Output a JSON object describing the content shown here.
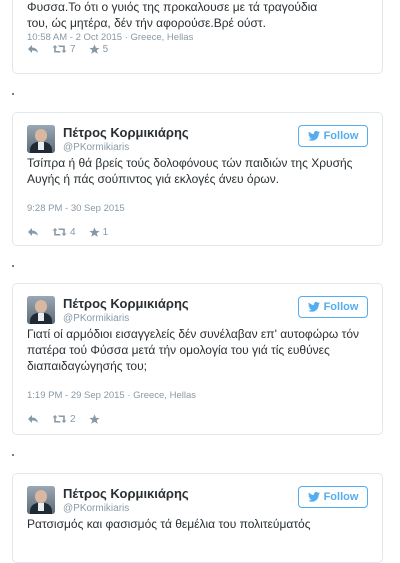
{
  "tweets": [
    {
      "text_line1": "Φυσσα.Το ότι ο γυιός της προκαλουσε με τά τραγούδια",
      "text_line2": "του, ώς μητέρα, δέν τήν αφορούσε.Βρέ ούστ.",
      "meta": "10:58 AM - 2 Oct 2015 · Greece, Hellas",
      "retweets": "7",
      "likes": "5"
    },
    {
      "name": "Πέτρος Κορμικιάρης",
      "handle": "@PKormikiaris",
      "follow_label": "Follow",
      "text": "Τσίπρα ή θά βρείς τούς δολοφόνους τών παιδιών της Χρυσής Αυγής ή πάς σούπιντος γιά εκλογές άνευ όρων.",
      "meta": "9:28 PM - 30 Sep 2015",
      "retweets": "4",
      "likes": "1"
    },
    {
      "name": "Πέτρος Κορμικιάρης",
      "handle": "@PKormikiaris",
      "follow_label": "Follow",
      "text": "Γιατί οί αρμόδιοι εισαγγελείς δέν συνέλαβαν επ' αυτοφώρω τόν πατέρα τού  Φύσσα μετά τήν ομολογία του γιά τίς ευθύνες διαπαιδαγώγησής του;",
      "meta": "1:19 PM - 29 Sep 2015 · Greece, Hellas",
      "retweets": "2",
      "likes": ""
    },
    {
      "name": "Πέτρος Κορμικιάρης",
      "handle": "@PKormikiaris",
      "follow_label": "Follow",
      "text": "Ρατσισμός και φασισμός τά θεμέλια του πολιτεύματός"
    }
  ],
  "colors": {
    "accent": "#55acee",
    "muted": "#8899a6",
    "text": "#292f33",
    "border": "#e1e8ed"
  },
  "icons": [
    "reply-icon",
    "retweet-icon",
    "like-star-icon",
    "twitter-bird-icon"
  ]
}
